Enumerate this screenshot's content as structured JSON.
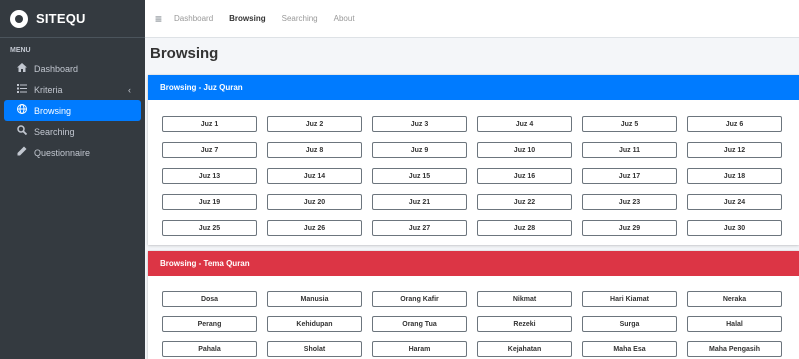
{
  "brand": {
    "name": "SITEQU"
  },
  "sidebar": {
    "header": "MENU",
    "items": [
      {
        "label": "Dashboard",
        "icon": "home-icon"
      },
      {
        "label": "Kriteria",
        "icon": "list-icon"
      },
      {
        "label": "Browsing",
        "icon": "globe-icon"
      },
      {
        "label": "Searching",
        "icon": "search-icon"
      },
      {
        "label": "Questionnaire",
        "icon": "pencil-icon"
      }
    ]
  },
  "topbar": {
    "links": [
      "Dashboard",
      "Browsing",
      "Searching",
      "About"
    ]
  },
  "page": {
    "title": "Browsing"
  },
  "juz_card": {
    "title": "Browsing - Juz Quran",
    "color": "#007bff",
    "items": [
      "Juz 1",
      "Juz 2",
      "Juz 3",
      "Juz 4",
      "Juz 5",
      "Juz 6",
      "Juz 7",
      "Juz 8",
      "Juz 9",
      "Juz 10",
      "Juz 11",
      "Juz 12",
      "Juz 13",
      "Juz 14",
      "Juz 15",
      "Juz 16",
      "Juz 17",
      "Juz 18",
      "Juz 19",
      "Juz 20",
      "Juz 21",
      "Juz 22",
      "Juz 23",
      "Juz 24",
      "Juz 25",
      "Juz 26",
      "Juz 27",
      "Juz 28",
      "Juz 29",
      "Juz 30"
    ]
  },
  "tema_card": {
    "title": "Browsing - Tema Quran",
    "color": "#dc3545",
    "items": [
      "Dosa",
      "Manusia",
      "Orang Kafir",
      "Nikmat",
      "Hari Kiamat",
      "Neraka",
      "Perang",
      "Kehidupan",
      "Orang Tua",
      "Rezeki",
      "Surga",
      "Halal",
      "Pahala",
      "Sholat",
      "Haram",
      "Kejahatan",
      "Maha Esa",
      "Maha Pengasih"
    ]
  }
}
